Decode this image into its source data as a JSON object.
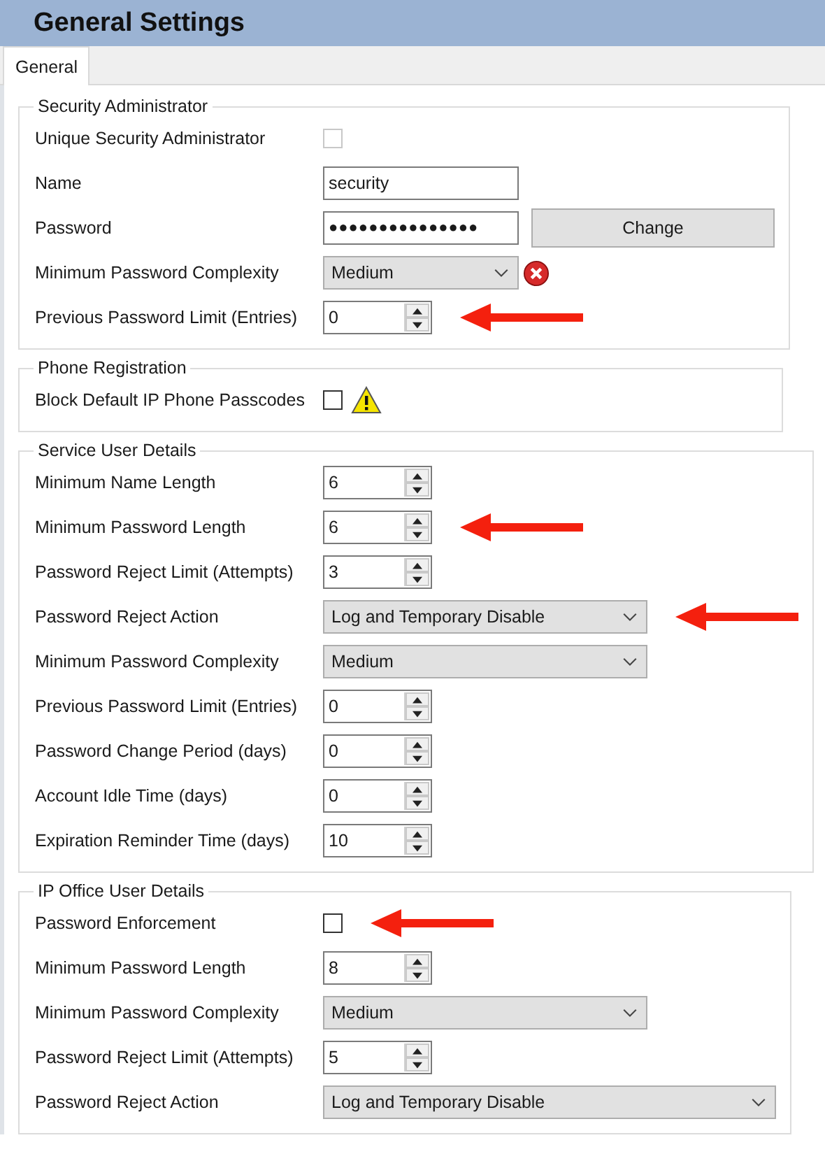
{
  "window": {
    "title": "General Settings"
  },
  "tabs": [
    {
      "label": "General",
      "selected": true
    }
  ],
  "groups": [
    {
      "title": "Security Administrator",
      "rows": [
        {
          "kind": "checkbox",
          "label": "Unique Security Administrator",
          "checked": false,
          "disabled": true
        },
        {
          "kind": "text",
          "label": "Name",
          "value": "security"
        },
        {
          "kind": "password",
          "label": "Password",
          "value": "●●●●●●●●●●●●●●●",
          "button": "Change"
        },
        {
          "kind": "dropdown",
          "label": "Minimum Password Complexity",
          "value": "Medium",
          "error": true
        },
        {
          "kind": "spinner",
          "label": "Previous Password Limit (Entries)",
          "value": "0",
          "arrow": true
        }
      ]
    },
    {
      "title": "Phone Registration",
      "rows": [
        {
          "kind": "checkbox",
          "label": "Block Default IP Phone Passcodes",
          "checked": false,
          "disabled": false,
          "warning": true
        }
      ]
    },
    {
      "title": "Service User Details",
      "rows": [
        {
          "kind": "spinner",
          "label": "Minimum Name Length",
          "value": "6"
        },
        {
          "kind": "spinner",
          "label": "Minimum Password Length",
          "value": "6",
          "arrow": true
        },
        {
          "kind": "spinner",
          "label": "Password Reject Limit (Attempts)",
          "value": "3"
        },
        {
          "kind": "dropdown",
          "label": "Password Reject Action",
          "value": "Log and Temporary Disable",
          "arrow": true
        },
        {
          "kind": "dropdown",
          "label": "Minimum Password Complexity",
          "value": "Medium"
        },
        {
          "kind": "spinner",
          "label": "Previous Password Limit (Entries)",
          "value": "0"
        },
        {
          "kind": "spinner",
          "label": "Password Change Period (days)",
          "value": "0"
        },
        {
          "kind": "spinner",
          "label": "Account Idle Time (days)",
          "value": "0"
        },
        {
          "kind": "spinner",
          "label": "Expiration Reminder Time (days)",
          "value": "10"
        }
      ]
    },
    {
      "title": "IP Office User Details",
      "rows": [
        {
          "kind": "checkbox",
          "label": "Password Enforcement",
          "checked": false,
          "disabled": false,
          "arrow": true
        },
        {
          "kind": "spinner",
          "label": "Minimum Password Length",
          "value": "8"
        },
        {
          "kind": "dropdown",
          "label": "Minimum Password Complexity",
          "value": "Medium"
        },
        {
          "kind": "spinner",
          "label": "Password Reject Limit (Attempts)",
          "value": "5"
        },
        {
          "kind": "dropdown",
          "label": "Password Reject Action",
          "value": "Log and Temporary Disable"
        }
      ]
    }
  ]
}
